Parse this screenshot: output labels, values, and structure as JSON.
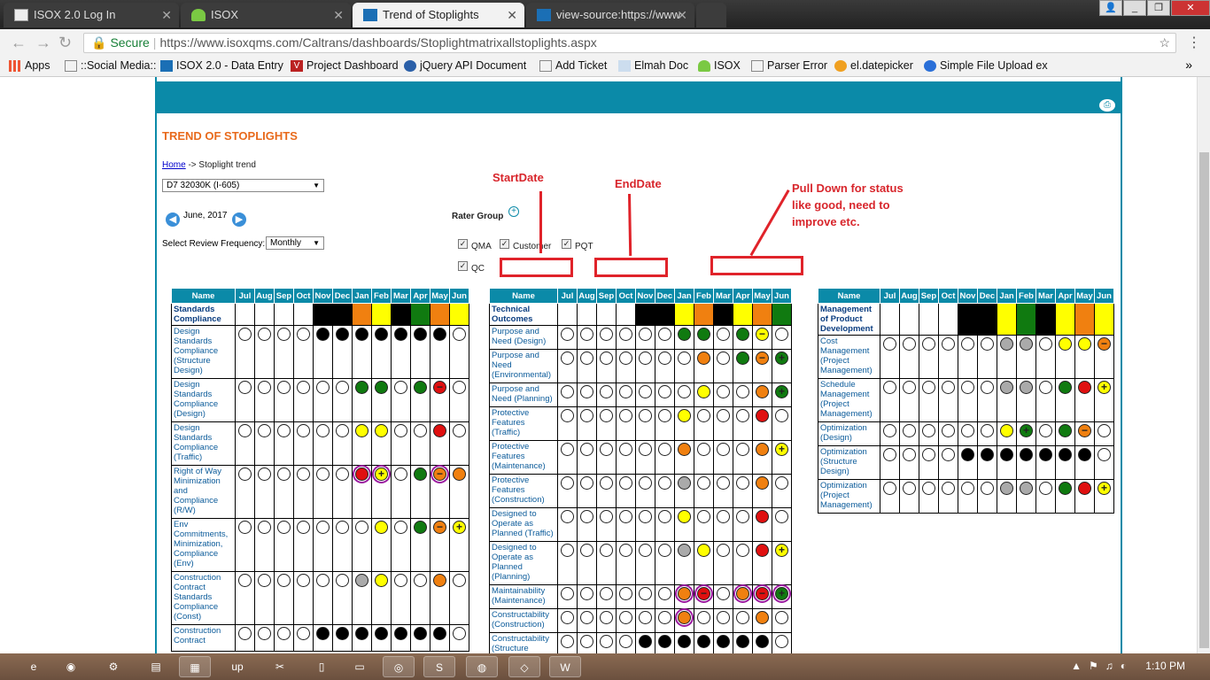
{
  "tabs": [
    {
      "title": "ISOX 2.0 Log In",
      "active": false
    },
    {
      "title": "ISOX",
      "active": false
    },
    {
      "title": "Trend of Stoplights",
      "active": true
    },
    {
      "title": "view-source:https://www",
      "active": false
    }
  ],
  "address": {
    "secure_label": "Secure",
    "url": "https://www.isoxqms.com/Caltrans/dashboards/Stoplightmatrixallstoplights.aspx"
  },
  "bookmarks": [
    "Apps",
    "::Social Media::",
    "ISOX 2.0 - Data Entry",
    "Project Dashboard",
    "jQuery API Document",
    "Add Ticket",
    "Elmah Doc",
    "ISOX",
    "Parser Error",
    "el.datepicker",
    "Simple File Upload ex"
  ],
  "page": {
    "title": "TREND OF STOPLIGHTS",
    "breadcrumb_home": "Home",
    "breadcrumb_rest": " -> Stoplight trend",
    "district": "D7 32030K (I-605)",
    "month": "June, 2017",
    "freq_label": "Select Review Frequency:",
    "freq_value": "Monthly",
    "rater_label": "Rater Group",
    "raters": [
      "QMA",
      "Customer",
      "PQT",
      "QC"
    ]
  },
  "annotations": {
    "start": "StartDate",
    "end": "EndDate",
    "pull": "Pull Down for status like good, need to improve etc."
  },
  "months": [
    "Jul",
    "Aug",
    "Sep",
    "Oct",
    "Nov",
    "Dec",
    "Jan",
    "Feb",
    "Mar",
    "Apr",
    "May",
    "Jun"
  ],
  "name_header": "Name",
  "legend_colors": {
    "w": "#ffffff",
    "b": "#000000",
    "g": "#107a10",
    "y": "#ffff00",
    "o": "#f08010",
    "r": "#e01010",
    "s": "#aaaaaa"
  },
  "tables": [
    {
      "group": "Standards Compliance",
      "header": [
        "w",
        "w",
        "w",
        "w",
        "b",
        "b",
        "o",
        "y",
        "b",
        "g",
        "o",
        "y"
      ],
      "rows": [
        {
          "name": "Design Standards Compliance (Structure Design)",
          "cells": [
            "w",
            "w",
            "w",
            "w",
            "b",
            "b",
            "b",
            "b",
            "b",
            "b",
            "b",
            "w"
          ],
          "h": 60
        },
        {
          "name": "Design Standards Compliance (Design)",
          "cells": [
            "w",
            "w",
            "w",
            "w",
            "w",
            "w",
            "g",
            "g",
            "w",
            "g",
            "r-",
            "w"
          ],
          "h": 49
        },
        {
          "name": "Design Standards Compliance (Traffic)",
          "cells": [
            "w",
            "w",
            "w",
            "w",
            "w",
            "w",
            "y",
            "y",
            "w",
            "w",
            "r",
            "w"
          ],
          "h": 49
        },
        {
          "name": "Right of Way Minimization and Compliance (R/W)",
          "cells": [
            "w",
            "w",
            "w",
            "w",
            "w",
            "w",
            "r*",
            "y+*",
            "w",
            "g",
            "o-*",
            "o"
          ],
          "h": 60
        },
        {
          "name": "Env Commitments, Minimization, Compliance (Env)",
          "cells": [
            "w",
            "w",
            "w",
            "w",
            "w",
            "w",
            "w",
            "y",
            "w",
            "g",
            "o-",
            "y+"
          ],
          "h": 60
        },
        {
          "name": "Construction Contract Standards Compliance (Const)",
          "cells": [
            "w",
            "w",
            "w",
            "w",
            "w",
            "w",
            "s",
            "y",
            "w",
            "w",
            "o",
            "w"
          ],
          "h": 60
        },
        {
          "name": "Construction Contract",
          "cells": [
            "w",
            "w",
            "w",
            "w",
            "b",
            "b",
            "b",
            "b",
            "b",
            "b",
            "b",
            "w"
          ],
          "h": 30
        }
      ]
    },
    {
      "group": "Technical Outcomes",
      "header": [
        "w",
        "w",
        "w",
        "w",
        "b",
        "b",
        "y",
        "o",
        "b",
        "y",
        "o",
        "g"
      ],
      "rows": [
        {
          "name": "Purpose and Need (Design)",
          "cells": [
            "w",
            "w",
            "w",
            "w",
            "w",
            "w",
            "g",
            "g",
            "w",
            "g",
            "y-",
            "w"
          ],
          "h": 27
        },
        {
          "name": "Purpose and Need (Environmental)",
          "cells": [
            "w",
            "w",
            "w",
            "w",
            "w",
            "w",
            "w",
            "o",
            "w",
            "g",
            "o-",
            "g+"
          ],
          "h": 38
        },
        {
          "name": "Purpose and Need (Planning)",
          "cells": [
            "w",
            "w",
            "w",
            "w",
            "w",
            "w",
            "w",
            "y",
            "w",
            "w",
            "o",
            "g+"
          ],
          "h": 27
        },
        {
          "name": "Protective Features (Traffic)",
          "cells": [
            "w",
            "w",
            "w",
            "w",
            "w",
            "w",
            "y",
            "w",
            "w",
            "w",
            "r",
            "w"
          ],
          "h": 38
        },
        {
          "name": "Protective Features (Maintenance)",
          "cells": [
            "w",
            "w",
            "w",
            "w",
            "w",
            "w",
            "o",
            "w",
            "w",
            "w",
            "o",
            "y+"
          ],
          "h": 38
        },
        {
          "name": "Protective Features (Construction)",
          "cells": [
            "w",
            "w",
            "w",
            "w",
            "w",
            "w",
            "s",
            "w",
            "w",
            "w",
            "o",
            "w"
          ],
          "h": 38
        },
        {
          "name": "Designed to Operate as Planned (Traffic)",
          "cells": [
            "w",
            "w",
            "w",
            "w",
            "w",
            "w",
            "y",
            "w",
            "w",
            "w",
            "r",
            "w"
          ],
          "h": 38
        },
        {
          "name": "Designed to Operate as Planned (Planning)",
          "cells": [
            "w",
            "w",
            "w",
            "w",
            "w",
            "w",
            "s",
            "y",
            "w",
            "w",
            "r",
            "y+"
          ],
          "h": 49
        },
        {
          "name": "Maintainability (Maintenance)",
          "cells": [
            "w",
            "w",
            "w",
            "w",
            "w",
            "w",
            "o*",
            "r-*",
            "w",
            "o*",
            "r-*",
            "g+*"
          ],
          "h": 27
        },
        {
          "name": "Constructability (Construction)",
          "cells": [
            "w",
            "w",
            "w",
            "w",
            "w",
            "w",
            "o*",
            "w",
            "w",
            "w",
            "o",
            "w"
          ],
          "h": 27
        },
        {
          "name": "Constructability (Structure",
          "cells": [
            "w",
            "w",
            "w",
            "w",
            "b",
            "b",
            "b",
            "b",
            "b",
            "b",
            "b",
            "w"
          ],
          "h": 27
        }
      ]
    },
    {
      "group": "Management of Product Development",
      "header": [
        "w",
        "w",
        "w",
        "w",
        "b",
        "b",
        "y",
        "g",
        "b",
        "y",
        "o",
        "y"
      ],
      "rows": [
        {
          "name": "Cost Management (Project Management)",
          "cells": [
            "w",
            "w",
            "w",
            "w",
            "w",
            "w",
            "s",
            "s",
            "w",
            "y",
            "y",
            "o-"
          ],
          "h": 49
        },
        {
          "name": "Schedule Management (Project Management)",
          "cells": [
            "w",
            "w",
            "w",
            "w",
            "w",
            "w",
            "s",
            "s",
            "w",
            "g",
            "r",
            "y+"
          ],
          "h": 49
        },
        {
          "name": "Optimization (Design)",
          "cells": [
            "w",
            "w",
            "w",
            "w",
            "w",
            "w",
            "y",
            "g+",
            "w",
            "g",
            "o-",
            "w"
          ],
          "h": 27
        },
        {
          "name": "Optimization (Structure Design)",
          "cells": [
            "w",
            "w",
            "w",
            "w",
            "b",
            "b",
            "b",
            "b",
            "b",
            "b",
            "b",
            "w"
          ],
          "h": 38
        },
        {
          "name": "Optimization (Project Management)",
          "cells": [
            "w",
            "w",
            "w",
            "w",
            "w",
            "w",
            "s",
            "s",
            "w",
            "g",
            "r",
            "y+"
          ],
          "h": 38
        }
      ]
    }
  ],
  "clock": "1:10 PM"
}
